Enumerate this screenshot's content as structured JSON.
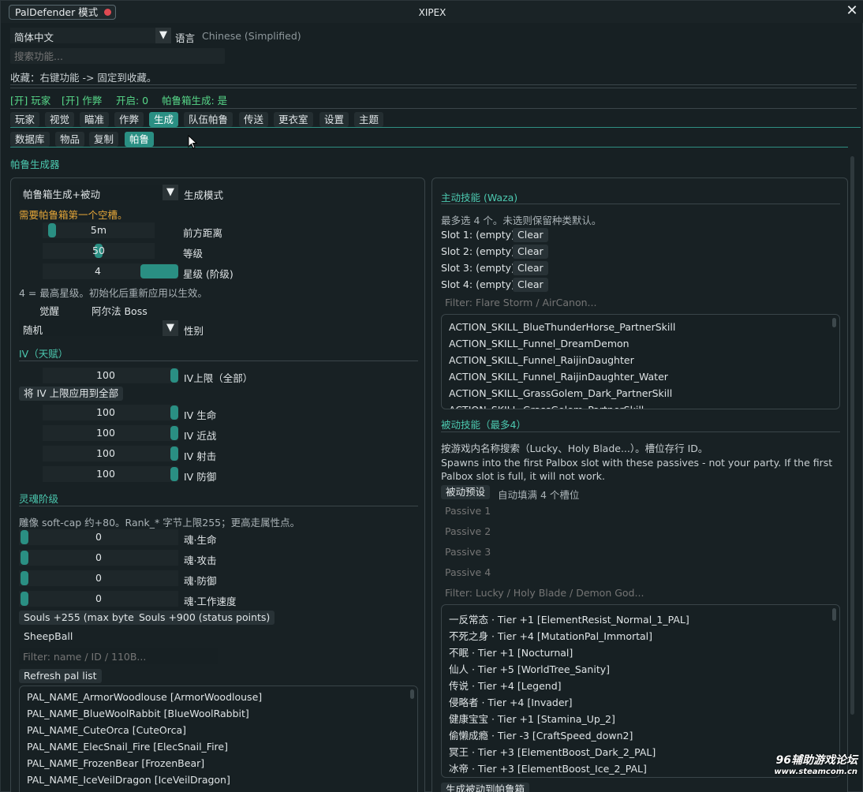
{
  "window": {
    "mode_badge": "PalDefender 模式",
    "title": "XIPEX",
    "close_glyph": "✕"
  },
  "language": {
    "selected": "简体中文",
    "label": "语言",
    "current": "Chinese (Simplified)"
  },
  "search": {
    "placeholder": "搜索功能..."
  },
  "favorites_hint": "收藏：右键功能 -> 固定到收藏。",
  "status": {
    "player": "[开] 玩家",
    "cheat": "[开] 作弊",
    "enabled": "开启: 0",
    "palbox_spawn": "帕鲁箱生成: 是"
  },
  "main_tabs": [
    "玩家",
    "视觉",
    "瞄准",
    "作弊",
    "生成",
    "队伍帕鲁",
    "传送",
    "更衣室",
    "设置",
    "主题"
  ],
  "main_tab_active": "生成",
  "sub_tabs": [
    "数据库",
    "物品",
    "复制",
    "帕鲁"
  ],
  "sub_tab_active": "帕鲁",
  "section_title": "帕鲁生成器",
  "left": {
    "spawn_mode": {
      "selected": "帕鲁箱生成+被动",
      "label": "生成模式"
    },
    "warning": "需要帕鲁箱第一个空槽。",
    "distance": {
      "value": "5m",
      "label": "前方距离",
      "fraction": 0.05
    },
    "level": {
      "value": "50",
      "label": "等级",
      "fraction": 0.5
    },
    "stars": {
      "value": "4",
      "label": "星级 (阶级)",
      "fraction": 1.0
    },
    "stars_hint": "4 = 最高星级。初始化后重新应用以生效。",
    "awaken": {
      "label": "觉醒",
      "value": "阿尔法 Boss"
    },
    "gender": {
      "selected": "随机",
      "label": "性别"
    },
    "iv": {
      "title": "IV（天赋）",
      "cap": {
        "value": "100",
        "label": "IV上限（全部）",
        "fraction": 1.0
      },
      "apply_button": "将 IV 上限应用到全部",
      "stats": [
        {
          "value": "100",
          "label": "IV 生命",
          "fraction": 1.0
        },
        {
          "value": "100",
          "label": "IV 近战",
          "fraction": 1.0
        },
        {
          "value": "100",
          "label": "IV 射击",
          "fraction": 1.0
        },
        {
          "value": "100",
          "label": "IV 防御",
          "fraction": 1.0
        }
      ]
    },
    "soul": {
      "title": "灵魂阶级",
      "hint": "雕像 soft-cap 约+80。Rank_* 字节上限255；更高走属性点。",
      "stats": [
        {
          "value": "0",
          "label": "魂·生命",
          "fraction": 0
        },
        {
          "value": "0",
          "label": "魂·攻击",
          "fraction": 0
        },
        {
          "value": "0",
          "label": "魂·防御",
          "fraction": 0
        },
        {
          "value": "0",
          "label": "魂·工作速度",
          "fraction": 0
        }
      ],
      "btn_max_byte": "Souls +255 (max byte)",
      "btn_status_points": "Souls +900 (status points)"
    },
    "selected_pal": "SheepBall",
    "pal_filter_placeholder": "Filter: name / ID / 110B...",
    "refresh_button": "Refresh pal list",
    "pal_list": [
      "PAL_NAME_ArmorWoodlouse [ArmorWoodlouse]",
      "PAL_NAME_BlueWoolRabbit [BlueWoolRabbit]",
      "PAL_NAME_CuteOrca [CuteOrca]",
      "PAL_NAME_ElecSnail_Fire [ElecSnail_Fire]",
      "PAL_NAME_FrozenBear [FrozenBear]",
      "PAL_NAME_IceVeilDragon [IceVeilDragon]"
    ]
  },
  "right": {
    "active_skills": {
      "title": "主动技能 (Waza)",
      "hint": "最多选 4 个。未选则保留种类默认。",
      "slots": [
        "Slot 1: (empty)",
        "Slot 2: (empty)",
        "Slot 3: (empty)",
        "Slot 4: (empty)"
      ],
      "clear_label": "Clear",
      "filter_placeholder": "Filter: Flare Storm / AirCanon...",
      "list": [
        "ACTION_SKILL_BlueThunderHorse_PartnerSkill",
        "ACTION_SKILL_Funnel_DreamDemon",
        "ACTION_SKILL_Funnel_RaijinDaughter",
        "ACTION_SKILL_Funnel_RaijinDaughter_Water",
        "ACTION_SKILL_GrassGolem_Dark_PartnerSkill",
        "ACTION_SKILL_GrassGolem_PartnerSkill"
      ]
    },
    "passive_skills": {
      "title": "被动技能（最多4）",
      "hint1": "按游戏内名称搜索（Lucky、Holy Blade...）。槽位存行 ID。",
      "hint2": "Spawns into the first Palbox slot with these passives - not your party. If the first Palbox slot is full, it will not work.",
      "preset_button": "被动预设",
      "autofill_label": "自动填满 4 个槽位",
      "passive_placeholders": [
        "Passive 1",
        "Passive 2",
        "Passive 3",
        "Passive 4"
      ],
      "filter_placeholder": "Filter: Lucky / Holy Blade / Demon God...",
      "list": [
        "一反常态 · Tier +1  [ElementResist_Normal_1_PAL]",
        "不死之身 · Tier +4  [MutationPal_Immortal]",
        "不眠 · Tier +1  [Nocturnal]",
        "仙人 · Tier +5  [WorldTree_Sanity]",
        "传说 · Tier +4  [Legend]",
        "侵略者 · Tier +4  [Invader]",
        "健康宝宝 · Tier +1  [Stamina_Up_2]",
        "偷懒成瘾 · Tier -3  [CraftSpeed_down2]",
        "冥王 · Tier +3  [ElementBoost_Dark_2_PAL]",
        "冰帝 · Tier +3  [ElementBoost_Ice_2_PAL]"
      ],
      "bottom_partial": "生成被动到帕鲁箱"
    }
  },
  "watermark": {
    "line1": "96辅助游戏论坛",
    "line2": "www.steamcom.cn"
  },
  "colors": {
    "accent": "#2a8f83",
    "green": "#57d889",
    "warning": "#e3a538",
    "badge_dot": "#e04a52"
  },
  "icons": [
    "close-icon",
    "chevron-down-icon",
    "record-dot-icon",
    "mouse-cursor-icon"
  ]
}
